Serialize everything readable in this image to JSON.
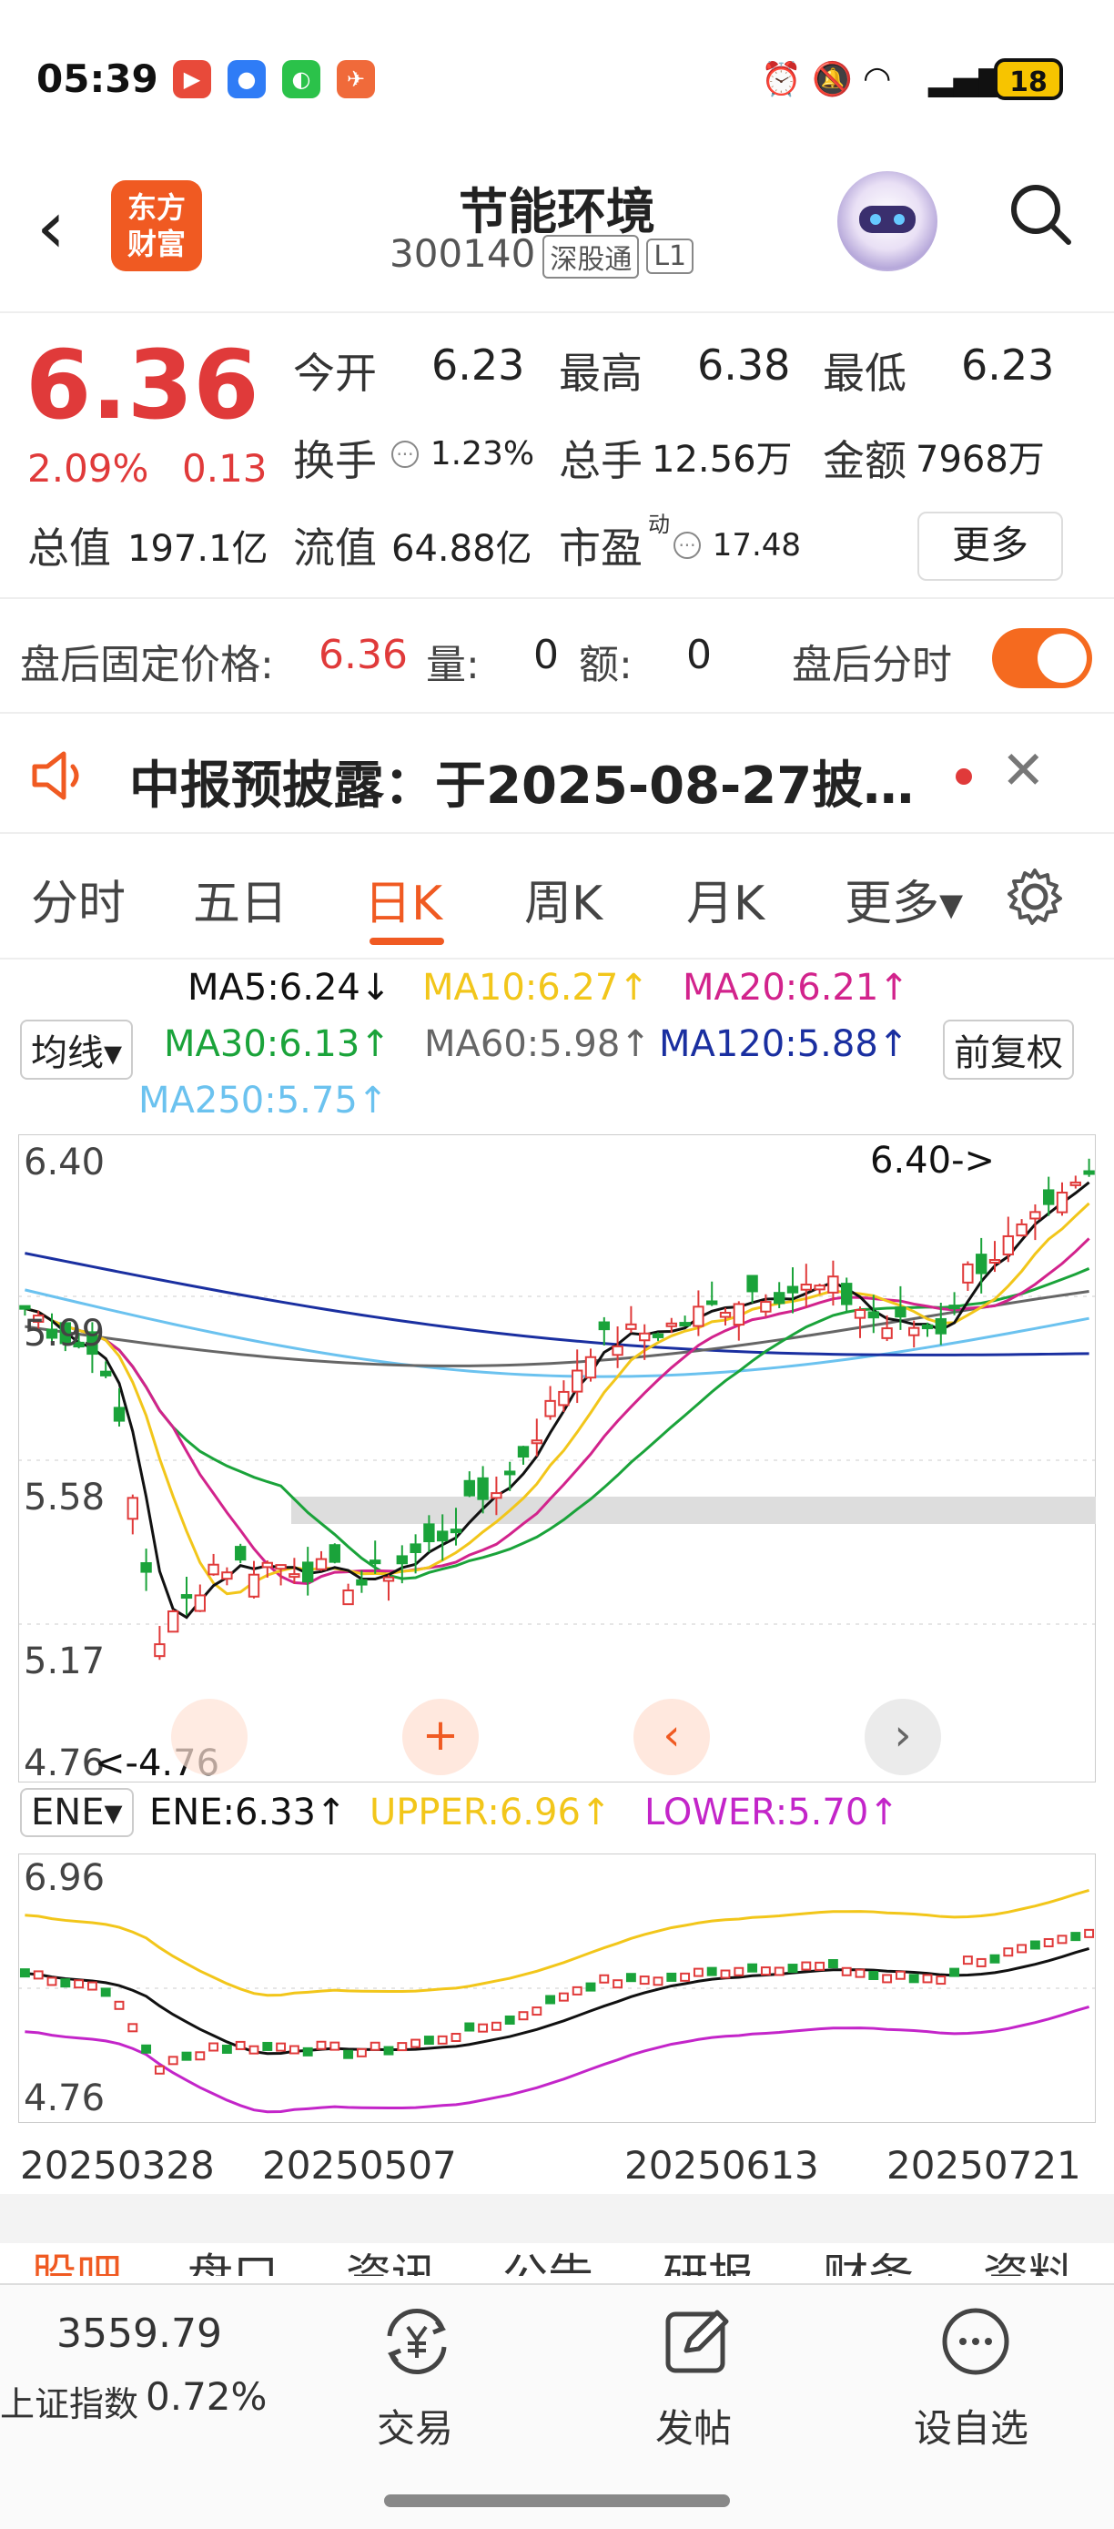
{
  "status_bar": {
    "time": "05:39",
    "battery": "18"
  },
  "header": {
    "back_icon": "chevron-left-icon",
    "logo_text": "东方财富",
    "stock_name": "节能环境",
    "stock_code": "300140",
    "badge_connect": "深股通",
    "badge_level": "L1"
  },
  "quote": {
    "price": "6.36",
    "change_pct": "2.09%",
    "change_amt": "0.13",
    "open_label": "今开",
    "open": "6.23",
    "high_label": "最高",
    "high": "6.38",
    "low_label": "最低",
    "low": "6.23",
    "turnover_label": "换手",
    "turnover": "1.23%",
    "volume_label": "总手",
    "volume": "12.56万",
    "amount_label": "金额",
    "amount": "7968万",
    "mktcap_label": "总值",
    "mktcap": "197.1亿",
    "float_label": "流值",
    "float_cap": "64.88亿",
    "pe_label": "市盈",
    "pe_sup": "动",
    "pe": "17.48",
    "more_button": "更多"
  },
  "after_hours": {
    "label": "盘后固定价格:",
    "price": "6.36",
    "vol_label": "量:",
    "vol": "0",
    "amt_label": "额:",
    "amt": "0",
    "timeshare_label": "盘后分时",
    "toggle_on": true
  },
  "notice": {
    "text": "中报预披露：于2025-08-27披…"
  },
  "tabs": [
    "分时",
    "五日",
    "日K",
    "周K",
    "月K",
    "更多▾"
  ],
  "active_tab": "日K",
  "ma_legend": {
    "selector": "均线▾",
    "ma5": "MA5:6.24↓",
    "ma10": "MA10:6.27↑",
    "ma20": "MA20:6.21↑",
    "ma30": "MA30:6.13↑",
    "ma60": "MA60:5.98↑",
    "ma120": "MA120:5.88↑",
    "ma250": "MA250:5.75↑",
    "adjust_button": "前复权"
  },
  "colors": {
    "up": "#e03a3a",
    "down": "#1aa33a",
    "ma5": "#111111",
    "ma10": "#f2c61a",
    "ma20": "#d2238c",
    "ma30": "#1aa33a",
    "ma60": "#666666",
    "ma120": "#1a2fa0",
    "ma250": "#6bc2ef",
    "accent": "#f05a22"
  },
  "kline": {
    "y_ticks": [
      "6.40",
      "5.99",
      "5.58",
      "5.17",
      "4.76"
    ],
    "max_marker": "6.40->",
    "min_marker": "<-4.76"
  },
  "ene": {
    "selector": "ENE▾",
    "ene": "ENE:6.33↑",
    "upper": "UPPER:6.96↑",
    "lower": "LOWER:5.70↑",
    "y_ticks": [
      "6.96",
      "4.76"
    ]
  },
  "x_dates": [
    "20250328",
    "20250507",
    "20250613",
    "20250721"
  ],
  "bottom_tabs_partial": [
    "股吧",
    "盘口",
    "资讯",
    "公告",
    "研报",
    "财务",
    "资料"
  ],
  "bottom_bar": {
    "index_value": "3559.79",
    "index_name": "上证指数",
    "index_change": "0.72%",
    "trade": "交易",
    "post": "发帖",
    "watchlist": "设自选"
  }
}
